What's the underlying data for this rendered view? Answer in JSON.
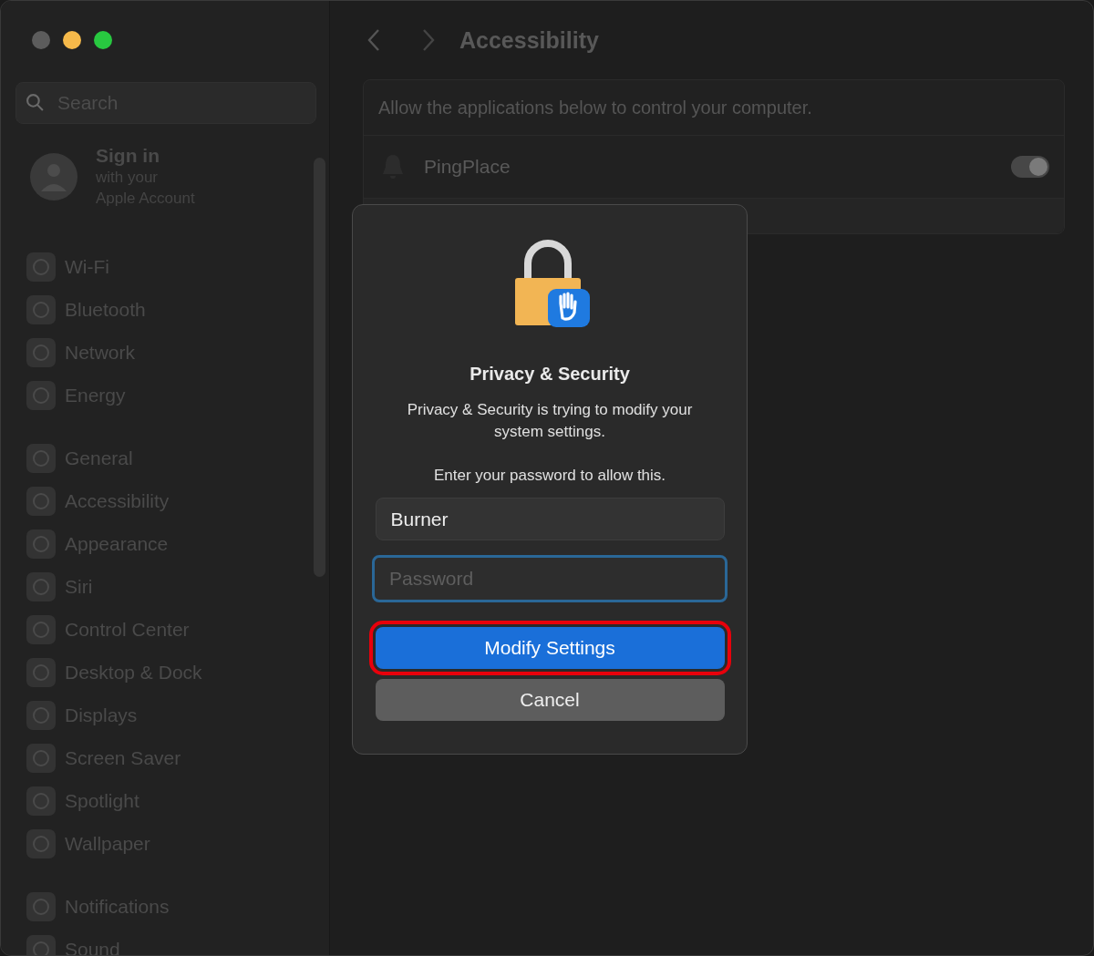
{
  "window": {
    "controls": [
      {
        "color": "#5c5c5c"
      },
      {
        "color": "#f6b94a"
      },
      {
        "color": "#28c840"
      }
    ]
  },
  "sidebar": {
    "search": {
      "placeholder": "Search"
    },
    "account": {
      "title": "Sign in",
      "subtitle": [
        "with your",
        "Apple Account"
      ]
    },
    "groups": [
      [
        {
          "label": "Wi-Fi",
          "selected": false
        },
        {
          "label": "Bluetooth",
          "selected": false
        },
        {
          "label": "Network",
          "selected": false
        },
        {
          "label": "Energy",
          "selected": false
        }
      ],
      [
        {
          "label": "General",
          "selected": false
        },
        {
          "label": "Accessibility",
          "selected": false
        },
        {
          "label": "Appearance",
          "selected": false
        },
        {
          "label": "Siri",
          "selected": false
        },
        {
          "label": "Control Center",
          "selected": false
        },
        {
          "label": "Desktop & Dock",
          "selected": false
        },
        {
          "label": "Displays",
          "selected": false
        },
        {
          "label": "Screen Saver",
          "selected": false
        },
        {
          "label": "Spotlight",
          "selected": false
        },
        {
          "label": "Wallpaper",
          "selected": false
        }
      ],
      [
        {
          "label": "Notifications",
          "selected": false
        },
        {
          "label": "Sound",
          "selected": false
        }
      ]
    ]
  },
  "header": {
    "title": "Accessibility"
  },
  "panel": {
    "description": "Allow the applications below to control your computer.",
    "apps": [
      {
        "name": "PingPlace",
        "on": true
      }
    ]
  },
  "dialog": {
    "title": "Privacy & Security",
    "message": "Privacy & Security is trying to modify your system settings.",
    "prompt": "Enter your password to allow this.",
    "username": {
      "value": "Burner"
    },
    "password": {
      "placeholder": "Password",
      "focused": true
    },
    "buttons": [
      {
        "label": "Modify Settings",
        "kind": "primary",
        "highlighted": true
      },
      {
        "label": "Cancel",
        "kind": "secondary",
        "highlighted": false
      }
    ]
  }
}
